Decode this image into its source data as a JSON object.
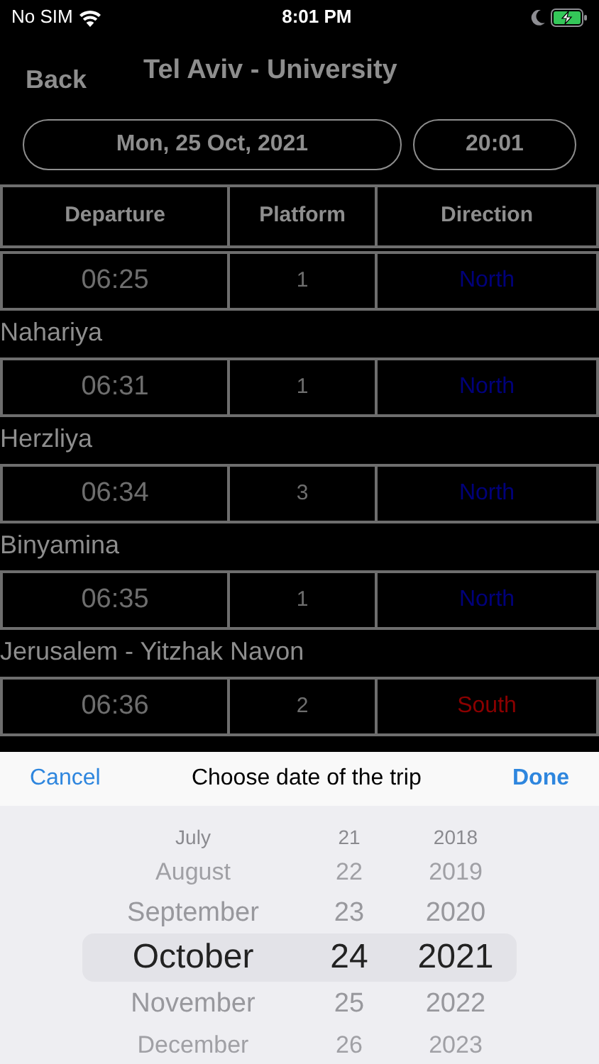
{
  "status_bar": {
    "carrier": "No SIM",
    "time": "8:01 PM"
  },
  "nav": {
    "back": "Back",
    "title": "Tel Aviv - University"
  },
  "date_button": "Mon, 25 Oct, 2021",
  "time_button": "20:01",
  "table": {
    "columns": [
      "Departure",
      "Platform",
      "Direction"
    ],
    "rows": [
      {
        "departure": "06:25",
        "platform": "1",
        "direction": "North",
        "color": "#00007a",
        "destination": "Nahariya"
      },
      {
        "departure": "06:31",
        "platform": "1",
        "direction": "North",
        "color": "#00007a",
        "destination": "Herzliya"
      },
      {
        "departure": "06:34",
        "platform": "3",
        "direction": "North",
        "color": "#00007a",
        "destination": "Binyamina"
      },
      {
        "departure": "06:35",
        "platform": "1",
        "direction": "North",
        "color": "#00007a",
        "destination": "Jerusalem - Yitzhak Navon"
      },
      {
        "departure": "06:36",
        "platform": "2",
        "direction": "South",
        "color": "#8b0000"
      }
    ]
  },
  "picker": {
    "cancel": "Cancel",
    "title": "Choose date of the trip",
    "done": "Done",
    "months": [
      {
        "label": "July",
        "selected": false
      },
      {
        "label": "August",
        "selected": false
      },
      {
        "label": "September",
        "selected": false
      },
      {
        "label": "October",
        "selected": true
      },
      {
        "label": "November",
        "selected": false
      },
      {
        "label": "December",
        "selected": false
      }
    ],
    "days": [
      {
        "label": "21",
        "selected": false
      },
      {
        "label": "22",
        "selected": false
      },
      {
        "label": "23",
        "selected": false
      },
      {
        "label": "24",
        "selected": true
      },
      {
        "label": "25",
        "selected": false
      },
      {
        "label": "26",
        "selected": false
      }
    ],
    "years": [
      {
        "label": "2018",
        "selected": false
      },
      {
        "label": "2019",
        "selected": false
      },
      {
        "label": "2020",
        "selected": false
      },
      {
        "label": "2021",
        "selected": true
      },
      {
        "label": "2022",
        "selected": false
      },
      {
        "label": "2023",
        "selected": false
      }
    ]
  }
}
